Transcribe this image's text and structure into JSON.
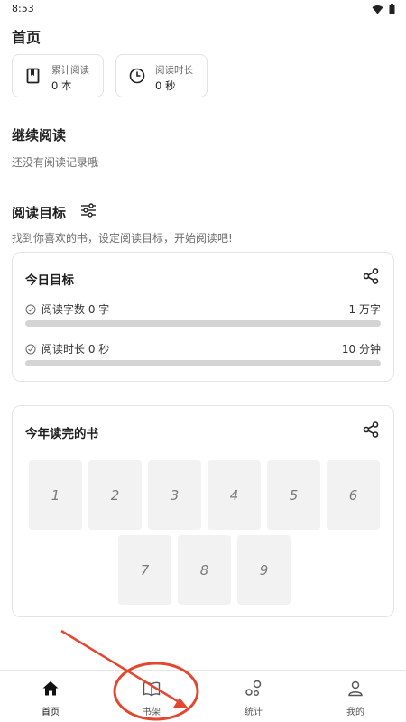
{
  "status_bar": {
    "time": "8:53",
    "icons": [
      "wifi-icon",
      "battery-icon"
    ]
  },
  "header": {
    "title": "首页"
  },
  "stats": [
    {
      "label": "累计阅读",
      "value": "0 本",
      "icon": "book-icon"
    },
    {
      "label": "阅读时长",
      "value": "0 秒",
      "icon": "clock-icon"
    }
  ],
  "continue_reading": {
    "title": "继续阅读",
    "empty_text": "还没有阅读记录哦"
  },
  "reading_goal": {
    "title": "阅读目标",
    "settings_icon": "sliders-icon",
    "subtitle": "找到你喜欢的书，设定阅读目标，开始阅读吧!"
  },
  "today_goal": {
    "title": "今日目标",
    "share_icon": "share-icon",
    "rows": [
      {
        "label": "阅读字数 0 字",
        "target": "1 万字",
        "progress": 0
      },
      {
        "label": "阅读时长 0 秒",
        "target": "10 分钟",
        "progress": 0
      }
    ]
  },
  "finished_books": {
    "title": "今年读完的书",
    "share_icon": "share-icon",
    "slots": [
      "1",
      "2",
      "3",
      "4",
      "5",
      "6",
      "7",
      "8",
      "9"
    ]
  },
  "bottom_nav": {
    "items": [
      {
        "label": "首页",
        "icon": "home-icon",
        "active": true
      },
      {
        "label": "书架",
        "icon": "open-book-icon",
        "active": false
      },
      {
        "label": "统计",
        "icon": "stats-icon",
        "active": false
      },
      {
        "label": "我的",
        "icon": "user-icon",
        "active": false
      }
    ]
  },
  "colors": {
    "annotation": "#e4472f",
    "progress_track": "#d4d4d4",
    "book_slot": "#f2f2f2"
  }
}
